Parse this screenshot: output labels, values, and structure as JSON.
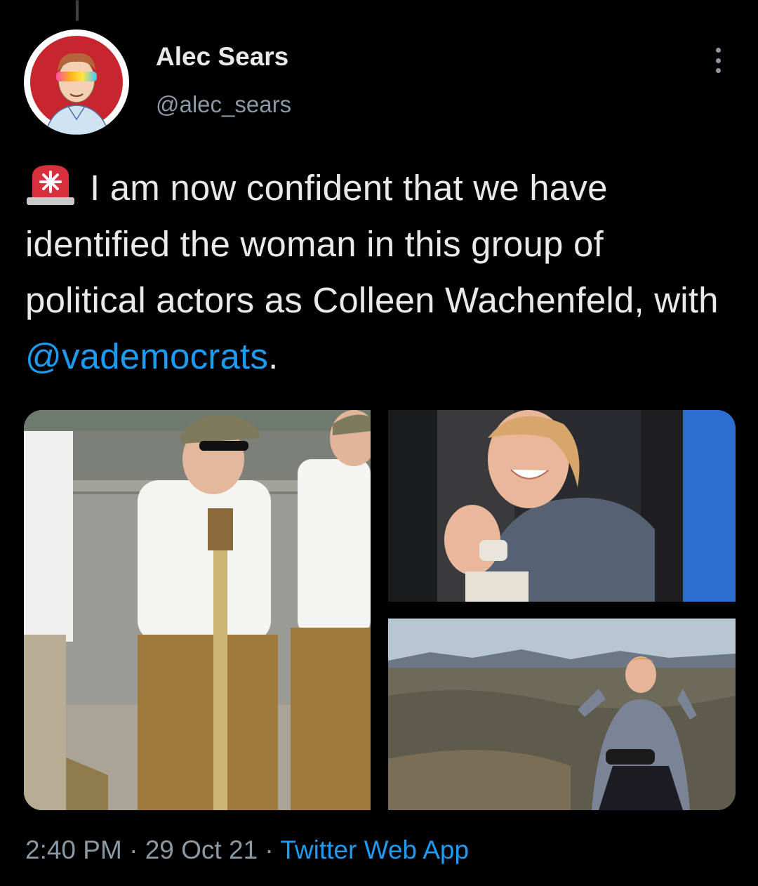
{
  "author": {
    "display_name": "Alec Sears",
    "handle": "@alec_sears"
  },
  "tweet": {
    "emoji": "rotating-light-emoji",
    "text_before_mention": "I am now confident that we have identified the woman in this group of political actors as Colleen Wachenfeld, with ",
    "mention": "@vademocrats",
    "text_after_mention": "."
  },
  "media": {
    "count": 3
  },
  "meta": {
    "time": "2:40 PM",
    "separator": "·",
    "date": "29 Oct 21",
    "source": "Twitter Web App"
  },
  "colors": {
    "background": "#000000",
    "text": "#e7e9ea",
    "secondary": "#8b98a5",
    "link": "#1d9bf0"
  }
}
